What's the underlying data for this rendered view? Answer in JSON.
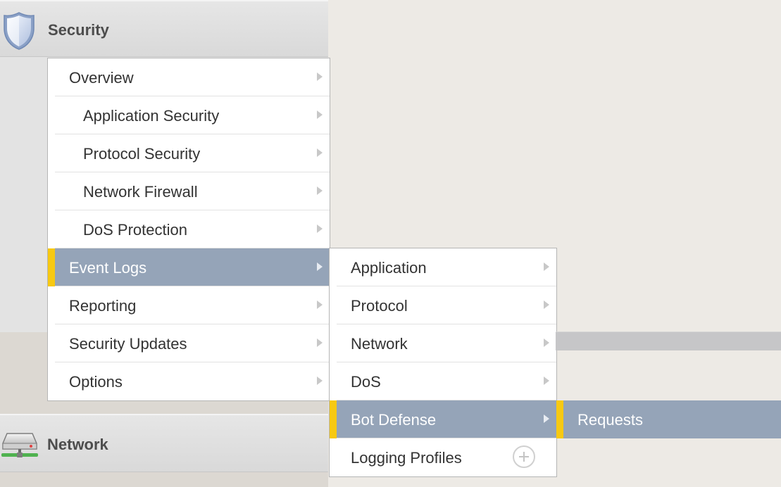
{
  "sidebar": {
    "sections": [
      {
        "title": "Security",
        "icon": "shield-icon"
      },
      {
        "title": "Network",
        "icon": "network-drive-icon"
      }
    ]
  },
  "security_menu": {
    "items": [
      {
        "label": "Overview"
      },
      {
        "label": "Application Security"
      },
      {
        "label": "Protocol Security"
      },
      {
        "label": "Network Firewall"
      },
      {
        "label": "DoS Protection"
      },
      {
        "label": "Event Logs",
        "active": true
      },
      {
        "label": "Reporting"
      },
      {
        "label": "Security Updates"
      },
      {
        "label": "Options"
      }
    ]
  },
  "event_logs_menu": {
    "items": [
      {
        "label": "Application"
      },
      {
        "label": "Protocol"
      },
      {
        "label": "Network"
      },
      {
        "label": "DoS"
      },
      {
        "label": "Bot Defense",
        "active": true
      },
      {
        "label": "Logging Profiles",
        "icon": "plus-circle-icon"
      }
    ]
  },
  "bot_defense_menu": {
    "items": [
      {
        "label": "Requests",
        "active": true
      }
    ]
  },
  "colors": {
    "active_item": "#95a4b8",
    "active_marker": "#f7c912",
    "sidebar_bg": "#e3e3e3",
    "page_bg": "#edeae5"
  }
}
